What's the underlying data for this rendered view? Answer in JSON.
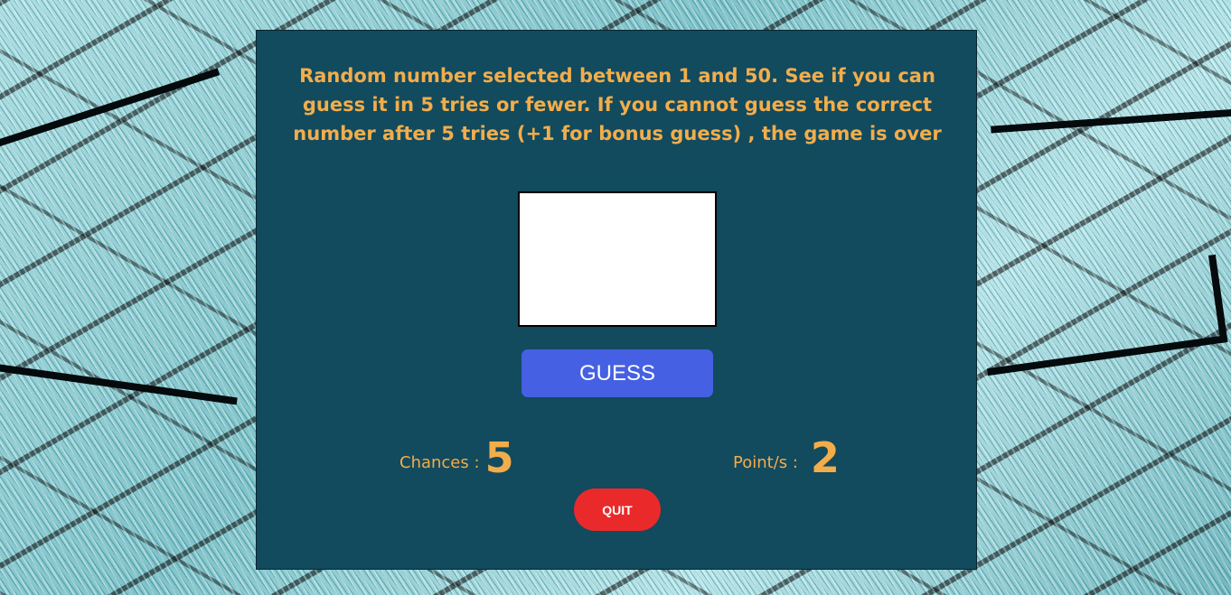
{
  "game": {
    "instructions": "Random number selected between 1 and 50. See if you can guess it in 5 tries or fewer. If you cannot guess the correct number after 5 tries (+1 for bonus guess) , the game is over",
    "guess_input": {
      "value": "",
      "placeholder": ""
    },
    "guess_button_label": "GUESS",
    "chances_label": "Chances :",
    "chances_value": "5",
    "points_label": "Point/s :",
    "points_value": "2",
    "quit_button_label": "QUIT"
  },
  "colors": {
    "panel_background": "#124a5e",
    "text_accent": "#f2ad4b",
    "guess_button": "#4560e2",
    "quit_button": "#ea2a2a"
  }
}
